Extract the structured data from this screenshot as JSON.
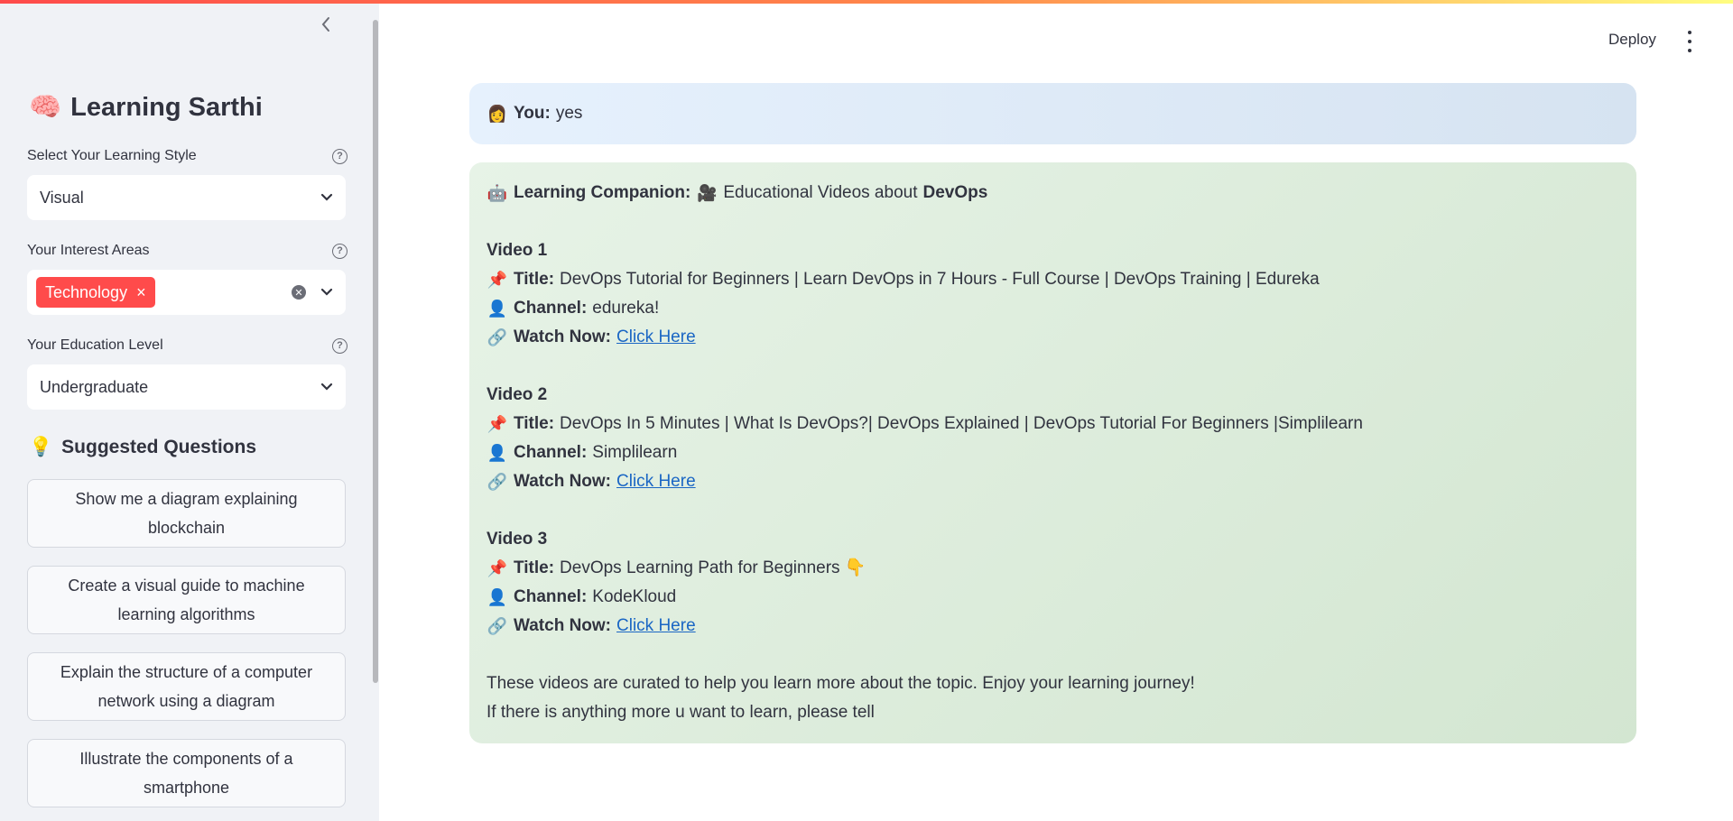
{
  "sidebar": {
    "app_title": "Learning Sarthi",
    "app_icon": "🧠",
    "learning_style": {
      "label": "Select Your Learning Style",
      "value": "Visual"
    },
    "interest_areas": {
      "label": "Your Interest Areas",
      "tags": [
        "Technology"
      ]
    },
    "education_level": {
      "label": "Your Education Level",
      "value": "Undergraduate"
    },
    "suggested": {
      "heading": "Suggested Questions",
      "icon": "💡",
      "items": [
        "Show me a diagram explaining blockchain",
        "Create a visual guide to machine learning algorithms",
        "Explain the structure of a computer network using a diagram",
        "Illustrate the components of a smartphone"
      ]
    }
  },
  "header": {
    "deploy_label": "Deploy"
  },
  "chat": {
    "user": {
      "icon": "👩",
      "label": "You:",
      "text": "yes"
    },
    "bot": {
      "icon": "🤖",
      "label": "Learning Companion:",
      "intro_icon": "🎥",
      "intro_text": "Educational Videos about",
      "intro_topic": "DevOps",
      "videos": [
        {
          "heading": "Video 1",
          "title_label": "Title:",
          "title": "DevOps Tutorial for Beginners | Learn DevOps in 7 Hours - Full Course | DevOps Training | Edureka",
          "channel_label": "Channel:",
          "channel": "edureka!",
          "watch_label": "Watch Now:",
          "link_text": "Click Here"
        },
        {
          "heading": "Video 2",
          "title_label": "Title:",
          "title": "DevOps In 5 Minutes | What Is DevOps?| DevOps Explained | DevOps Tutorial For Beginners |Simplilearn",
          "channel_label": "Channel:",
          "channel": "Simplilearn",
          "watch_label": "Watch Now:",
          "link_text": "Click Here"
        },
        {
          "heading": "Video 3",
          "title_label": "Title:",
          "title": "DevOps Learning Path for Beginners 👇",
          "channel_label": "Channel:",
          "channel": "KodeKloud",
          "watch_label": "Watch Now:",
          "link_text": "Click Here"
        }
      ],
      "footer_line1": "These videos are curated to help you learn more about the topic. Enjoy your learning journey!",
      "footer_line2": "If there is anything more u want to learn, please tell"
    }
  },
  "icons": {
    "pin": "📌",
    "person": "👤",
    "link": "🔗"
  },
  "colors": {
    "accent": "#ff4b4b",
    "link": "#1a66c4",
    "user_bubble": "#e6f1fd",
    "bot_bubble": "#e7f3e7"
  }
}
